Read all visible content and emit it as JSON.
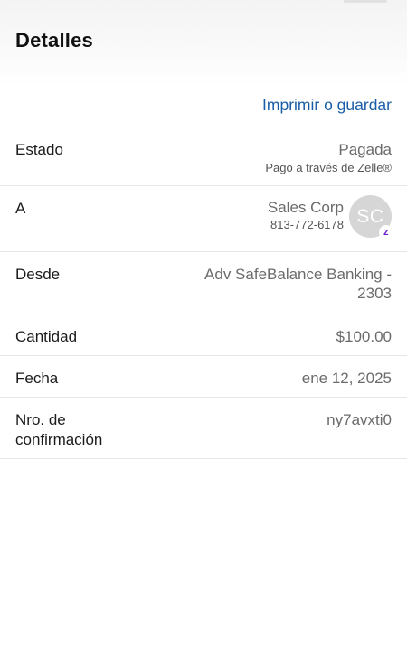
{
  "header": {
    "title": "Detalles"
  },
  "actions": {
    "print_label": "Imprimir o guardar"
  },
  "details": {
    "estado": {
      "label": "Estado",
      "value": "Pagada",
      "sub": "Pago a través de Zelle®"
    },
    "a": {
      "label": "A",
      "name": "Sales Corp",
      "phone": "813-772-6178",
      "avatar_initials": "SC",
      "badge_icon": "zelle-icon",
      "badge_glyph": "z",
      "badge_color": "#6d1ed4"
    },
    "desde": {
      "label": "Desde",
      "value": "Adv SafeBalance Banking - 2303"
    },
    "cantidad": {
      "label": "Cantidad",
      "value": "$100.00"
    },
    "fecha": {
      "label": "Fecha",
      "value": "ene 12, 2025"
    },
    "confirmacion": {
      "label": "Nro. de confirmación",
      "value": "ny7avxti0"
    }
  },
  "colors": {
    "link": "#1a5ea8",
    "avatar_bg": "#d6d6d6"
  }
}
